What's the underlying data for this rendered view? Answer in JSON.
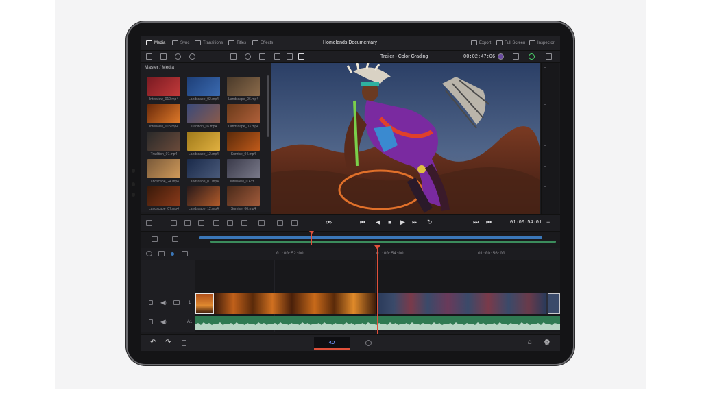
{
  "menu": {
    "items": [
      {
        "label": "Media",
        "icon": "media-icon",
        "active": true
      },
      {
        "label": "Sync",
        "icon": "sync-icon"
      },
      {
        "label": "Transitions",
        "icon": "transitions-icon"
      },
      {
        "label": "Titles",
        "icon": "titles-icon"
      },
      {
        "label": "Effects",
        "icon": "effects-icon"
      }
    ],
    "project_title": "Homelands Documentary",
    "right": [
      {
        "label": "Export",
        "icon": "export-icon"
      },
      {
        "label": "Full Screen",
        "icon": "fullscreen-icon"
      },
      {
        "label": "Inspector",
        "icon": "inspector-icon"
      }
    ]
  },
  "toolbar": {
    "timeline_name": "Trailer - Color Grading",
    "timecode": "00:02:47:06"
  },
  "media_pool": {
    "breadcrumb": "Master / Media",
    "clips": [
      {
        "label": "Interview_010.mp4",
        "c1": "#7a1a22",
        "c2": "#c23a3a"
      },
      {
        "label": "Landscape_02.mp4",
        "c1": "#1e3f78",
        "c2": "#3a6ab0"
      },
      {
        "label": "Landscape_06.mp4",
        "c1": "#4a3a2a",
        "c2": "#8a6a4a"
      },
      {
        "label": "Interview_015.mp4",
        "c1": "#6a2a0a",
        "c2": "#e07a2a"
      },
      {
        "label": "Tradition_06.mp4",
        "c1": "#3a4a7a",
        "c2": "#8a5a4a"
      },
      {
        "label": "Landscape_03.mp4",
        "c1": "#6a3a1a",
        "c2": "#b0603a"
      },
      {
        "label": "Tradition_07.mp4",
        "c1": "#2a2a2a",
        "c2": "#6a4a3a"
      },
      {
        "label": "Landscape_12.mp4",
        "c1": "#a07a1a",
        "c2": "#e0b040"
      },
      {
        "label": "Sunrise_04.mp4",
        "c1": "#5a2a0a",
        "c2": "#c05a1a"
      },
      {
        "label": "Landscape_24.mp4",
        "c1": "#7a5a3a",
        "c2": "#d09a5a"
      },
      {
        "label": "Landscape_01.mp4",
        "c1": "#1a2a4a",
        "c2": "#4a5a7a"
      },
      {
        "label": "Interview_0.Ext...",
        "c1": "#3a3a4a",
        "c2": "#7a7a8a"
      },
      {
        "label": "Landscape_07.mp4",
        "c1": "#3a1a0a",
        "c2": "#8a3a1a"
      },
      {
        "label": "Landscape_12.mp4",
        "c1": "#2a1a1a",
        "c2": "#b05a2a"
      },
      {
        "label": "Sunrise_06.mp4",
        "c1": "#4a2a1a",
        "c2": "#a05a3a"
      }
    ]
  },
  "transport": {
    "timecode": "01:00:54:01"
  },
  "ruler": {
    "marks": [
      "01:00:52:00",
      "01:00:54:00",
      "01:00:56:00"
    ]
  },
  "tracks": {
    "video_label": "1",
    "audio_label": "A1"
  },
  "bottom": {
    "page_label": "4D"
  },
  "colors": {
    "accent": "#e0503a",
    "video_track": "#3b77b8",
    "audio_track": "#2f7a52"
  }
}
